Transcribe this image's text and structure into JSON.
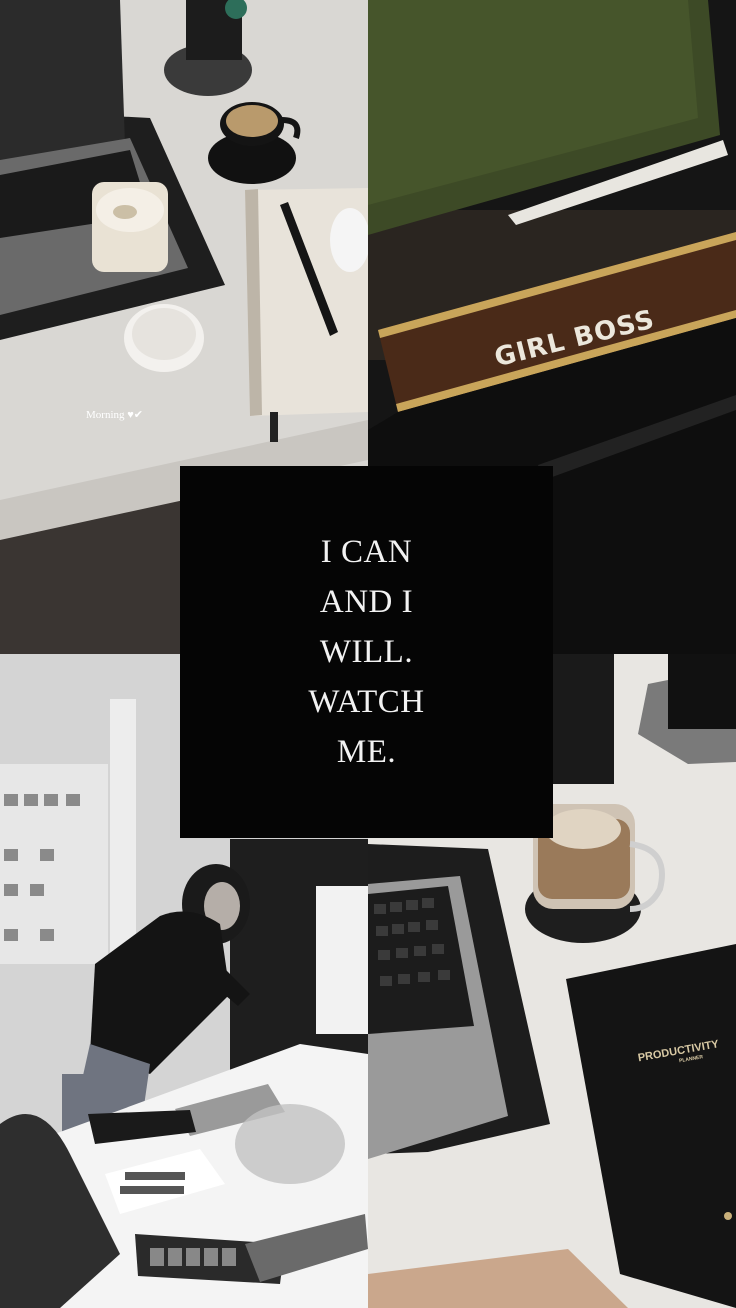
{
  "quote": {
    "lines": [
      "I CAN",
      "AND I",
      "WILL.",
      "WATCH",
      "ME."
    ]
  },
  "top_left": {
    "caption": "Morning ♥✔"
  },
  "top_right": {
    "nameplate_text": "GIRL BOSS"
  },
  "bottom_right": {
    "planner_title": "PRODUCTIVITY",
    "planner_subtitle": "PLANNER"
  }
}
